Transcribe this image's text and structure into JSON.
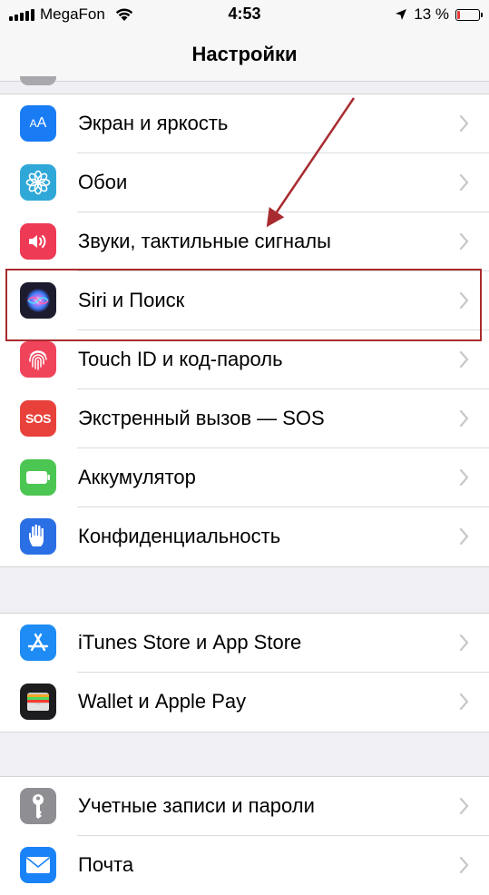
{
  "status_bar": {
    "carrier": "MegaFon",
    "time": "4:53",
    "battery": "13 %",
    "battery_level": 0.13,
    "battery_color": "#e53935"
  },
  "nav": {
    "title": "Настройки"
  },
  "groups": [
    {
      "items": [
        {
          "label": "Экран и яркость",
          "icon": "display-brightness-icon",
          "icon_color": "#1a7cf5"
        },
        {
          "label": "Обои",
          "icon": "wallpaper-flower-icon",
          "icon_color": "#2fa8d8"
        },
        {
          "label": "Звуки, тактильные сигналы",
          "icon": "speaker-icon",
          "icon_color": "#ee3a55"
        },
        {
          "label": "Siri и Поиск",
          "icon": "siri-icon",
          "icon_color": "#1c1c2e"
        },
        {
          "label": "Touch ID и код-пароль",
          "icon": "fingerprint-icon",
          "icon_color": "#f0445b"
        },
        {
          "label": "Экстренный вызов — SOS",
          "icon": "sos-icon",
          "icon_color": "#e8413b",
          "icon_text": "SOS"
        },
        {
          "label": "Аккумулятор",
          "icon": "battery-icon",
          "icon_color": "#4cc652"
        },
        {
          "label": "Конфиденциальность",
          "icon": "hand-icon",
          "icon_color": "#2b6fe4"
        }
      ]
    },
    {
      "items": [
        {
          "label": "iTunes Store и App Store",
          "icon": "app-store-icon",
          "icon_color": "#1e8cf4"
        },
        {
          "label": "Wallet и Apple Pay",
          "icon": "wallet-icon",
          "icon_color": "#1d1d1f"
        }
      ]
    },
    {
      "items": [
        {
          "label": "Учетные записи и пароли",
          "icon": "key-icon",
          "icon_color": "#8e8e93"
        },
        {
          "label": "Почта",
          "icon": "mail-icon",
          "icon_color": "#1a82f7"
        }
      ]
    }
  ],
  "annotation": {
    "highlight_color": "#a82b2f"
  }
}
